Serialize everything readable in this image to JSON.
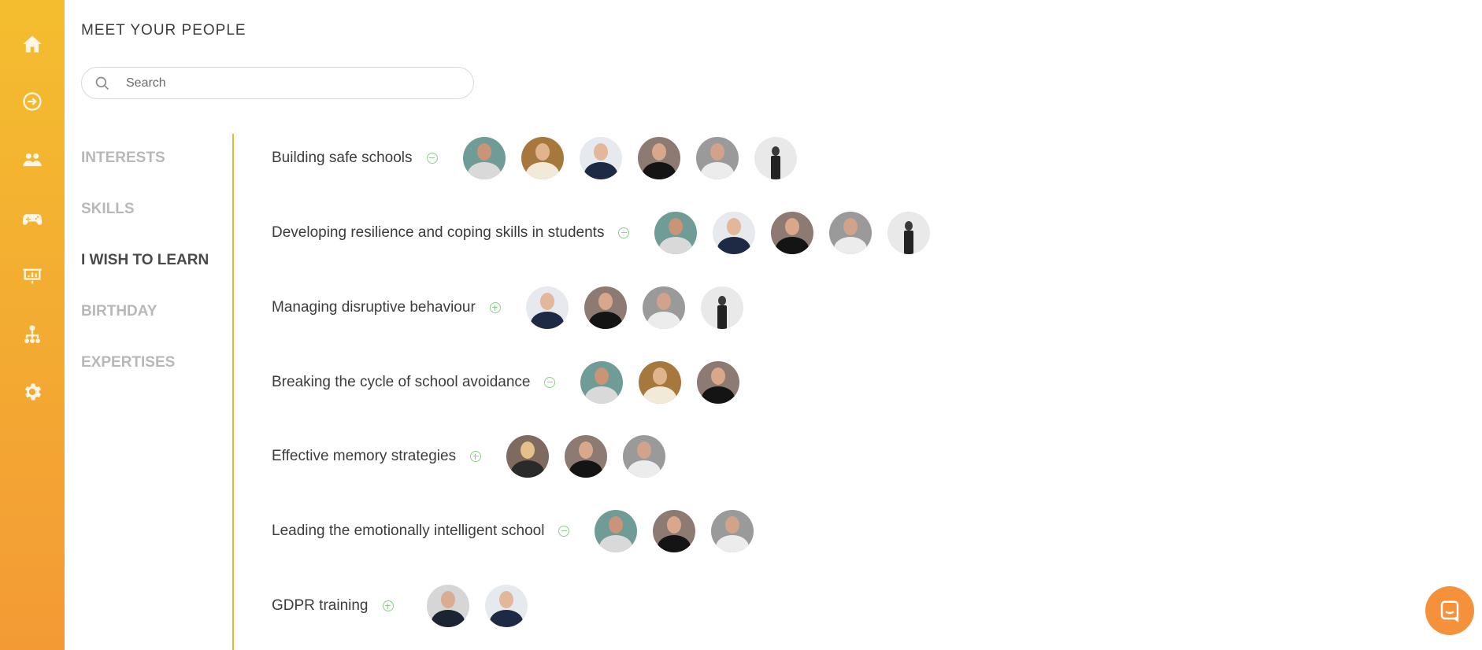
{
  "rail": {
    "icons": [
      "home-icon",
      "arrow-right-circle-icon",
      "people-icon",
      "gamepad-icon",
      "presentation-board-icon",
      "org-chart-icon",
      "gear-icon"
    ]
  },
  "page": {
    "title": "MEET YOUR PEOPLE"
  },
  "search": {
    "placeholder": "Search"
  },
  "categories": [
    {
      "label": "INTERESTS",
      "active": false
    },
    {
      "label": "SKILLS",
      "active": false
    },
    {
      "label": "I WISH TO LEARN",
      "active": true
    },
    {
      "label": "BIRTHDAY",
      "active": false
    },
    {
      "label": "EXPERTISES",
      "active": false
    }
  ],
  "topics": [
    {
      "label": "Building safe schools",
      "toggle": "minus",
      "avatar_count": 6
    },
    {
      "label": "Developing resilience and coping skills in students",
      "toggle": "minus",
      "avatar_count": 5
    },
    {
      "label": "Managing disruptive behaviour",
      "toggle": "plus",
      "avatar_count": 4
    },
    {
      "label": "Breaking the cycle of school avoidance",
      "toggle": "minus",
      "avatar_count": 3
    },
    {
      "label": "Effective memory strategies",
      "toggle": "plus",
      "avatar_count": 3
    },
    {
      "label": "Leading the emotionally intelligent school",
      "toggle": "minus",
      "avatar_count": 3
    },
    {
      "label": "GDPR training",
      "toggle": "plus",
      "avatar_count": 2
    }
  ],
  "colors": {
    "accent": "#f3aa32",
    "toggle": "#8ccf8c",
    "chat": "#f4913a"
  },
  "chat": {
    "icon": "chat-bubble-icon"
  }
}
